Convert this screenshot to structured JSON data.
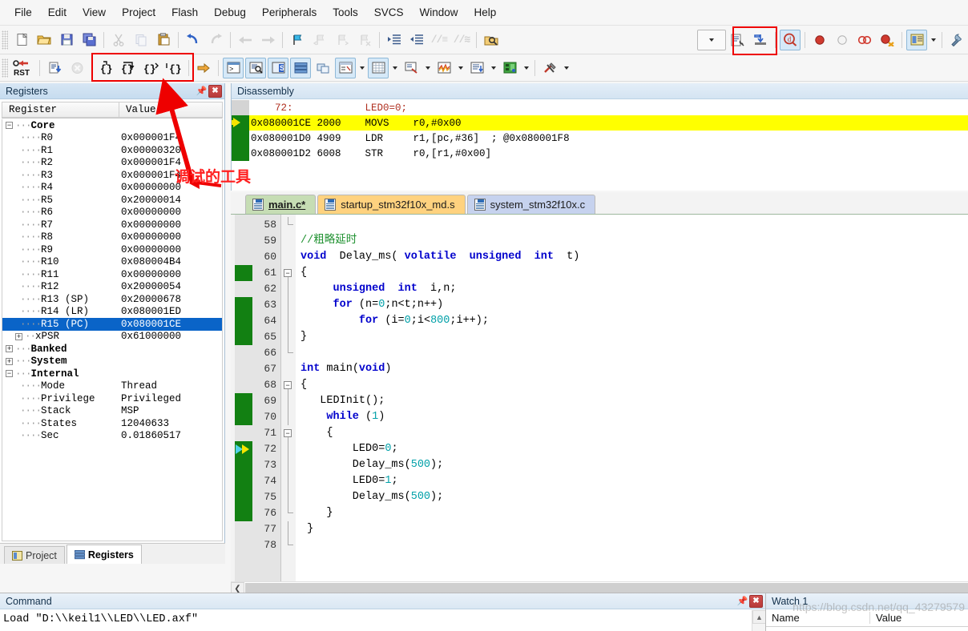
{
  "menu": {
    "items": [
      "File",
      "Edit",
      "View",
      "Project",
      "Flash",
      "Debug",
      "Peripherals",
      "Tools",
      "SVCS",
      "Window",
      "Help"
    ]
  },
  "toolbar_main": {
    "icons": [
      {
        "name": "new-file-icon",
        "glyph": "⎕",
        "state": "normal"
      },
      {
        "name": "open-file-icon",
        "glyph": "📂",
        "state": "normal"
      },
      {
        "name": "save-icon",
        "glyph": "💾",
        "state": "normal"
      },
      {
        "name": "save-all-icon",
        "glyph": "🖫",
        "state": "normal"
      },
      {
        "name": "cut-icon",
        "glyph": "✂",
        "state": "disabled"
      },
      {
        "name": "copy-icon",
        "glyph": "❐",
        "state": "disabled"
      },
      {
        "name": "paste-icon",
        "glyph": "📋",
        "state": "normal"
      },
      {
        "name": "undo-icon",
        "glyph": "↶",
        "state": "normal"
      },
      {
        "name": "redo-icon",
        "glyph": "↷",
        "state": "disabled"
      },
      {
        "name": "navigate-back-icon",
        "glyph": "←",
        "state": "disabled"
      },
      {
        "name": "navigate-forward-icon",
        "glyph": "→",
        "state": "disabled"
      },
      {
        "name": "bookmark-toggle-icon",
        "glyph": "⚑",
        "state": "normal"
      },
      {
        "name": "bookmark-prev-icon",
        "glyph": "⚑",
        "state": "disabled"
      },
      {
        "name": "bookmark-next-icon",
        "glyph": "⚑",
        "state": "disabled"
      },
      {
        "name": "bookmark-clear-icon",
        "glyph": "⚑",
        "state": "disabled"
      },
      {
        "name": "indent-right-icon",
        "glyph": "⇥",
        "state": "normal"
      },
      {
        "name": "indent-left-icon",
        "glyph": "⇤",
        "state": "normal"
      },
      {
        "name": "comment-lines-icon",
        "glyph": "//",
        "state": "disabled"
      },
      {
        "name": "uncomment-lines-icon",
        "glyph": "//",
        "state": "disabled"
      },
      {
        "name": "find-in-files-icon",
        "glyph": "🔎",
        "state": "normal"
      }
    ],
    "right_icons": [
      {
        "name": "target-select-dropdown",
        "glyph": "⌄",
        "state": "normal"
      },
      {
        "name": "build-target-icon",
        "glyph": "📑",
        "state": "normal"
      },
      {
        "name": "download-to-flash-icon",
        "glyph": "⬇",
        "state": "normal"
      },
      {
        "name": "start-stop-debug-icon",
        "glyph": "🔍",
        "state": "active"
      },
      {
        "name": "insert-breakpoint-icon",
        "glyph": "⬤",
        "state": "normal"
      },
      {
        "name": "disable-breakpoint-icon",
        "glyph": "○",
        "state": "normal"
      },
      {
        "name": "disable-all-breakpoints-icon",
        "glyph": "⚭",
        "state": "normal"
      },
      {
        "name": "kill-all-breakpoints-icon",
        "glyph": "⬤",
        "state": "normal"
      },
      {
        "name": "manage-windows-icon",
        "glyph": "▤",
        "state": "active"
      },
      {
        "name": "configure-target-icon",
        "glyph": "🔧",
        "state": "normal"
      }
    ]
  },
  "toolbar_debug": {
    "reset_label": "RST",
    "icons": [
      {
        "name": "reset-cpu-icon",
        "glyph": "RST",
        "state": "normal"
      },
      {
        "name": "run-icon",
        "glyph": "⬇",
        "state": "normal"
      },
      {
        "name": "stop-icon",
        "glyph": "✖",
        "state": "disabled"
      },
      {
        "name": "step-into-icon",
        "glyph": "{}",
        "state": "normal"
      },
      {
        "name": "step-over-icon",
        "glyph": "{}",
        "state": "normal"
      },
      {
        "name": "step-out-icon",
        "glyph": "{}",
        "state": "normal"
      },
      {
        "name": "run-to-cursor-icon",
        "glyph": "{}",
        "state": "normal"
      },
      {
        "name": "show-next-statement-icon",
        "glyph": "⇒",
        "state": "normal"
      },
      {
        "name": "command-window-icon",
        "glyph": "⌨",
        "state": "active"
      },
      {
        "name": "disassembly-window-icon",
        "glyph": "🔎",
        "state": "active"
      },
      {
        "name": "symbols-window-icon",
        "glyph": "S",
        "state": "active"
      },
      {
        "name": "registers-window-icon",
        "glyph": "≣",
        "state": "active"
      },
      {
        "name": "call-stack-window-icon",
        "glyph": "⧉",
        "state": "normal"
      },
      {
        "name": "watch-windows-icon",
        "glyph": "🗔",
        "state": "active"
      },
      {
        "name": "memory-windows-icon",
        "glyph": "▦",
        "state": "active"
      },
      {
        "name": "serial-windows-icon",
        "glyph": "🖵",
        "state": "normal"
      },
      {
        "name": "analysis-windows-icon",
        "glyph": "〜",
        "state": "normal"
      },
      {
        "name": "trace-windows-icon",
        "glyph": "≡",
        "state": "normal"
      },
      {
        "name": "system-viewer-icon",
        "glyph": "▩",
        "state": "normal"
      },
      {
        "name": "toolbox-icon",
        "glyph": "🔨",
        "state": "normal"
      }
    ]
  },
  "registers_panel": {
    "title": "Registers",
    "columns": [
      "Register",
      "Value"
    ],
    "groups": [
      {
        "name": "Core",
        "expanded": true,
        "rows": [
          {
            "name": "R0",
            "value": "0x000001F4"
          },
          {
            "name": "R1",
            "value": "0x00000320"
          },
          {
            "name": "R2",
            "value": "0x000001F4"
          },
          {
            "name": "R3",
            "value": "0x000001F4"
          },
          {
            "name": "R4",
            "value": "0x00000000"
          },
          {
            "name": "R5",
            "value": "0x20000014"
          },
          {
            "name": "R6",
            "value": "0x00000000"
          },
          {
            "name": "R7",
            "value": "0x00000000"
          },
          {
            "name": "R8",
            "value": "0x00000000"
          },
          {
            "name": "R9",
            "value": "0x00000000"
          },
          {
            "name": "R10",
            "value": "0x080004B4"
          },
          {
            "name": "R11",
            "value": "0x00000000"
          },
          {
            "name": "R12",
            "value": "0x20000054"
          },
          {
            "name": "R13 (SP)",
            "value": "0x20000678"
          },
          {
            "name": "R14 (LR)",
            "value": "0x080001ED"
          },
          {
            "name": "R15 (PC)",
            "value": "0x080001CE",
            "selected": true
          },
          {
            "name": "xPSR",
            "value": "0x61000000",
            "expandable": true
          }
        ]
      },
      {
        "name": "Banked",
        "expanded": false,
        "rows": []
      },
      {
        "name": "System",
        "expanded": false,
        "rows": []
      },
      {
        "name": "Internal",
        "expanded": true,
        "rows": [
          {
            "name": "Mode",
            "value": "Thread"
          },
          {
            "name": "Privilege",
            "value": "Privileged"
          },
          {
            "name": "Stack",
            "value": "MSP"
          },
          {
            "name": "States",
            "value": "12040633"
          },
          {
            "name": "Sec",
            "value": "0.01860517"
          }
        ]
      }
    ],
    "tabs": [
      {
        "label": "Project",
        "active": false
      },
      {
        "label": "Registers",
        "active": true
      }
    ]
  },
  "disassembly_panel": {
    "title": "Disassembly",
    "lines": [
      {
        "kind": "source",
        "gutter": "grey",
        "text": "    72:            LED0=0;"
      },
      {
        "kind": "code",
        "gutter": "arrow",
        "highlight": true,
        "address": "0x080001CE",
        "opcode": "2000",
        "mnemonic": "MOVS",
        "operands": "r0,#0x00"
      },
      {
        "kind": "code",
        "gutter": "green",
        "highlight": false,
        "address": "0x080001D0",
        "opcode": "4909",
        "mnemonic": "LDR",
        "operands": "r1,[pc,#36]  ; @0x080001F8"
      },
      {
        "kind": "code",
        "gutter": "green",
        "highlight": false,
        "address": "0x080001D2",
        "opcode": "6008",
        "mnemonic": "STR",
        "operands": "r0,[r1,#0x00]"
      }
    ]
  },
  "editor": {
    "tabs": [
      {
        "label": "main.c*",
        "color": "t-green",
        "active": true
      },
      {
        "label": "startup_stm32f10x_md.s",
        "color": "t-orange",
        "active": false
      },
      {
        "label": "system_stm32f10x.c",
        "color": "t-blue",
        "active": false
      }
    ],
    "first_line": 58,
    "lines": [
      {
        "num": 58,
        "code": "",
        "fold": "end",
        "bp": false,
        "exec": false
      },
      {
        "num": 59,
        "code": "//粗略延时",
        "syntax": "comment",
        "fold": "none",
        "bp": false,
        "exec": false
      },
      {
        "num": 60,
        "code": "void  Delay_ms( volatile  unsigned  int  t)",
        "fold": "none",
        "bp": false,
        "exec": false
      },
      {
        "num": 61,
        "code": "{",
        "fold": "minus",
        "bp": true,
        "exec": false
      },
      {
        "num": 62,
        "code": "     unsigned  int  i,n;",
        "fold": "bar",
        "bp": false,
        "exec": false
      },
      {
        "num": 63,
        "code": "     for (n=0;n<t;n++)",
        "fold": "bar",
        "bp": true,
        "exec": false
      },
      {
        "num": 64,
        "code": "         for (i=0;i<800;i++);",
        "fold": "bar",
        "bp": true,
        "exec": false
      },
      {
        "num": 65,
        "code": "}",
        "fold": "bar",
        "bp": true,
        "exec": false
      },
      {
        "num": 66,
        "code": "",
        "fold": "end",
        "bp": false,
        "exec": false
      },
      {
        "num": 67,
        "code": "int main(void)",
        "fold": "none",
        "bp": false,
        "exec": false
      },
      {
        "num": 68,
        "code": "{",
        "fold": "minus",
        "bp": false,
        "exec": false
      },
      {
        "num": 69,
        "code": "   LEDInit();",
        "fold": "bar",
        "bp": true,
        "exec": false
      },
      {
        "num": 70,
        "code": "    while (1)",
        "fold": "bar",
        "bp": true,
        "exec": false
      },
      {
        "num": 71,
        "code": "    {",
        "fold": "minus",
        "bp": false,
        "exec": false
      },
      {
        "num": 72,
        "code": "        LED0=0;",
        "fold": "bar",
        "bp": true,
        "exec": true
      },
      {
        "num": 73,
        "code": "        Delay_ms(500);",
        "fold": "bar",
        "bp": true,
        "exec": false
      },
      {
        "num": 74,
        "code": "        LED0=1;",
        "fold": "bar",
        "bp": true,
        "exec": false
      },
      {
        "num": 75,
        "code": "        Delay_ms(500);",
        "fold": "bar",
        "bp": true,
        "exec": false
      },
      {
        "num": 76,
        "code": "    }",
        "fold": "end",
        "bp": true,
        "exec": false
      },
      {
        "num": 77,
        "code": " }",
        "fold": "bar",
        "bp": false,
        "exec": false
      },
      {
        "num": 78,
        "code": "",
        "fold": "end",
        "bp": false,
        "exec": false
      }
    ]
  },
  "command_panel": {
    "title": "Command",
    "lines": [
      "Load \"D:\\\\keil1\\\\LED\\\\LED.axf\""
    ]
  },
  "watch_panel": {
    "title": "Watch 1",
    "columns": [
      "Name",
      "Value"
    ]
  },
  "annotation": {
    "text": "调试的工具",
    "color": "#ff2020"
  },
  "watermark": {
    "text": "https://blog.csdn.net/qq_43279579"
  },
  "colors": {
    "breakpoint_green": "#128012",
    "exec_highlight": "#ffff00",
    "selection_blue": "#0a64c8",
    "annotation_red": "#ee0000",
    "tab_active_green": "#c6ddb4",
    "tab_orange": "#ffd27f",
    "tab_blue": "#c6d2ee"
  }
}
